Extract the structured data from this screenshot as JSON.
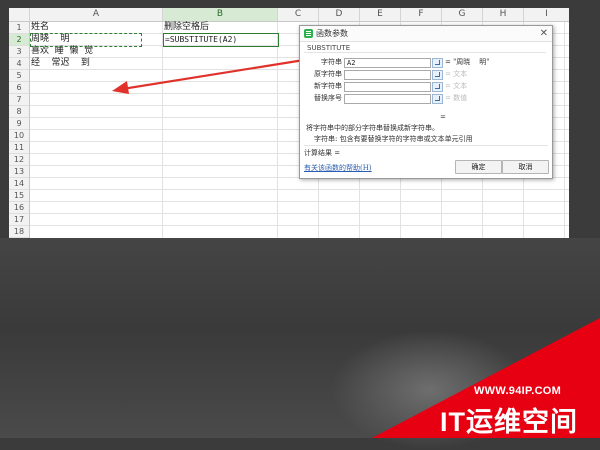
{
  "spreadsheet": {
    "columns": [
      "A",
      "B",
      "C",
      "D",
      "E",
      "F",
      "G",
      "H",
      "I"
    ],
    "rows": [
      "1",
      "2",
      "3",
      "4",
      "5",
      "6",
      "7",
      "8",
      "9",
      "10",
      "11",
      "12",
      "13",
      "14",
      "15",
      "16",
      "17",
      "18"
    ],
    "cells": {
      "A1": "姓名",
      "A2": "周晓    明",
      "A3": "喜欢  睡  懒  觉",
      "A4": "经    常迟    到",
      "B1": "删除空格后",
      "B2": "=SUBSTITUTE(A2)"
    },
    "selected_column": "B",
    "selected_row": "2"
  },
  "dialog": {
    "title": "函数参数",
    "close_glyph": "✕",
    "function_name": "SUBSTITUTE",
    "arguments": [
      {
        "label": "字符串",
        "value": "A2",
        "result": "= \"周晓    明\""
      },
      {
        "label": "原字符串",
        "value": "",
        "result": "= 文本"
      },
      {
        "label": "新字符串",
        "value": "",
        "result": "= 文本"
      },
      {
        "label": "替换序号",
        "value": "",
        "result": "= 数值"
      }
    ],
    "equals": "=",
    "description": "将字符串中的部分字符串替换成新字符串。",
    "arg_description": "字符串: 包含有要替换字符的字符串或文本单元引用",
    "result_label": "计算结果 =",
    "help_link": "有关该函数的帮助(H)",
    "ok_label": "确定",
    "cancel_label": "取消"
  },
  "watermark": {
    "url": "WWW.94IP.COM",
    "brand": "IT运维空间",
    "color": "#e60012"
  },
  "colors": {
    "selection_green": "#2f7d32",
    "arrow_red": "#e0322a"
  }
}
